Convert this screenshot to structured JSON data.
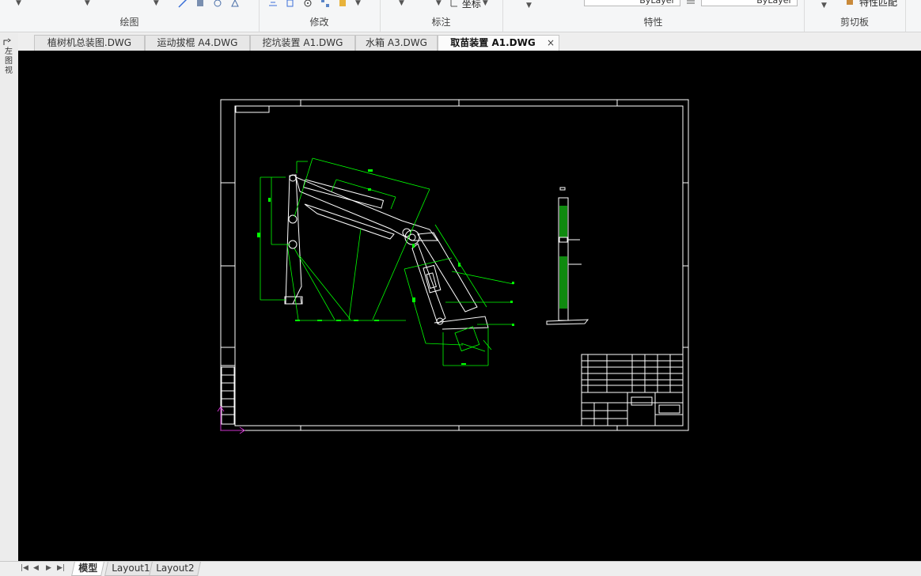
{
  "ribbon": {
    "groups": [
      {
        "label": "绘图"
      },
      {
        "label": "修改"
      },
      {
        "label": "标注",
        "tool": "坐标"
      },
      {
        "label": "特性",
        "layer_value_1": "ByLayer",
        "layer_value_2": "ByLayer"
      },
      {
        "label": "剪切板",
        "tool": "特性匹配"
      }
    ]
  },
  "tabs": [
    {
      "label": "植树机总装图.DWG"
    },
    {
      "label": "运动拔棍 A4.DWG"
    },
    {
      "label": "挖坑装置 A1.DWG"
    },
    {
      "label": "水箱 A3.DWG"
    },
    {
      "label": "取苗装置 A1.DWG",
      "active": true,
      "close": "×"
    }
  ],
  "left_strip": {
    "items": [
      "左",
      "图",
      "视"
    ]
  },
  "layout_tabs": [
    {
      "label": "模型",
      "active": true
    },
    {
      "label": "Layout1"
    },
    {
      "label": "Layout2"
    }
  ],
  "colors": {
    "canvas": "#000000",
    "frame": "#ffffff",
    "dimension": "#00ff00",
    "hatch": "#0f8a0f",
    "ucs": "#cc33cc"
  }
}
